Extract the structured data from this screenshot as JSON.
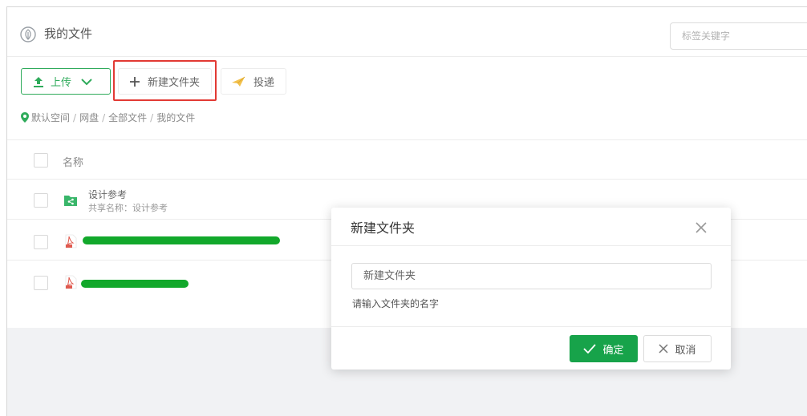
{
  "header": {
    "title": "我的文件",
    "tag_search_placeholder": "标签关键字"
  },
  "toolbar": {
    "upload_label": "上传",
    "new_folder_label": "新建文件夹",
    "deliver_label": "投递"
  },
  "breadcrumb": [
    "默认空间",
    "网盘",
    "全部文件",
    "我的文件"
  ],
  "table": {
    "name_column": "名称",
    "rows": [
      {
        "type": "shared-folder",
        "name": "设计参考",
        "subtitle": "共享名称：设计参考"
      },
      {
        "type": "pdf",
        "name": "",
        "subtitle": ""
      },
      {
        "type": "pdf",
        "name": "",
        "subtitle": ""
      }
    ]
  },
  "dialog": {
    "title": "新建文件夹",
    "input_value": "",
    "input_placeholder": "新建文件夹",
    "hint": "请输入文件夹的名字",
    "ok_label": "确定",
    "cancel_label": "取消"
  },
  "colors": {
    "brand_green": "#2fab5b",
    "confirm_green": "#17a34a",
    "highlight_red": "#e23a34",
    "redaction_green": "#12a82b",
    "pdf_red": "#e05a4f"
  },
  "icons": {
    "title": "shield-leaf-icon",
    "upload": "upload-arrow-icon",
    "dropdown": "chevron-down-icon",
    "new_folder": "plus-icon",
    "deliver": "paper-plane-icon",
    "location": "location-pin-icon",
    "shared_folder": "shared-folder-icon",
    "pdf": "pdf-file-icon",
    "close": "close-icon",
    "confirm": "check-icon",
    "cancel": "x-icon"
  }
}
